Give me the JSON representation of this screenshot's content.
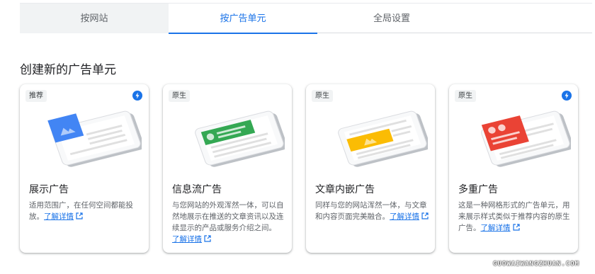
{
  "tabs": [
    {
      "label": "按网站",
      "active": false
    },
    {
      "label": "按广告单元",
      "active": true
    },
    {
      "label": "全局设置",
      "active": false
    }
  ],
  "section_title": "创建新的广告单元",
  "cards": [
    {
      "badge": "推荐",
      "has_bolt": true,
      "title": "展示广告",
      "desc": "适用范围广，在任何空间都能投放。",
      "learn": "了解详情",
      "illus_icon": "image-icon",
      "accent": "#4285f4"
    },
    {
      "badge": "原生",
      "has_bolt": false,
      "title": "信息流广告",
      "desc": "与您网站的外观浑然一体，可以自然地展示在推送的文章资讯以及连续显示的产品或服务介绍之间。",
      "learn": "了解详情",
      "illus_icon": "in-feed-icon",
      "accent": "#34a853"
    },
    {
      "badge": "原生",
      "has_bolt": false,
      "title": "文章内嵌广告",
      "desc": "同样与您的网站浑然一体，与文章和内容页面完美融合。",
      "learn": "了解详情",
      "illus_icon": "in-article-icon",
      "accent": "#fbbc04"
    },
    {
      "badge": "原生",
      "has_bolt": true,
      "title": "多重广告",
      "desc": "这是一种网格形式的广告单元，用来展示样式类似于推荐内容的原生广告。",
      "learn": "了解详情",
      "illus_icon": "multiplex-icon",
      "accent": "#ea4335"
    }
  ],
  "watermark": "GUOWAIWANGZHUAN.COM"
}
